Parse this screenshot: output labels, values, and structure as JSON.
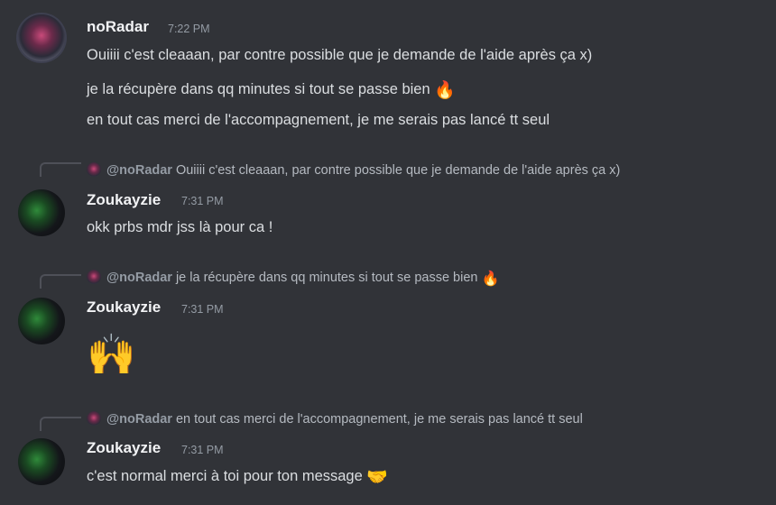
{
  "messages": {
    "first": {
      "author": "noRadar",
      "time": "7:22 PM",
      "lines": [
        "Ouiiii c'est cleaaan, par contre possible que je demande de l'aide après ça x)",
        "je la récupère dans qq minutes si tout se passe bien",
        "en tout cas merci de l'accompagnement, je me serais pas lancé tt seul"
      ],
      "emoji_line2": "🔥"
    },
    "reply1": {
      "reply_mention": "@noRadar",
      "reply_text": "Ouiiii c'est cleaaan, par contre possible que je demande de l'aide après ça x)",
      "author": "Zoukayzie",
      "time": "7:31 PM",
      "text": "okk prbs mdr jss là pour ca !"
    },
    "reply2": {
      "reply_mention": "@noRadar",
      "reply_text": "je la récupère dans qq minutes si tout se passe bien",
      "reply_emoji": "🔥",
      "author": "Zoukayzie",
      "time": "7:31 PM",
      "emoji": "🙌"
    },
    "reply3": {
      "reply_mention": "@noRadar",
      "reply_text": "en tout cas merci de l'accompagnement, je me serais pas lancé tt seul",
      "author": "Zoukayzie",
      "time": "7:31 PM",
      "text": "c'est normal merci à toi pour ton message",
      "emoji": "🤝"
    }
  },
  "colors": {
    "background": "#313338",
    "text": "#dbdee1",
    "author": "#f2f3f5",
    "muted": "#949ba4"
  }
}
